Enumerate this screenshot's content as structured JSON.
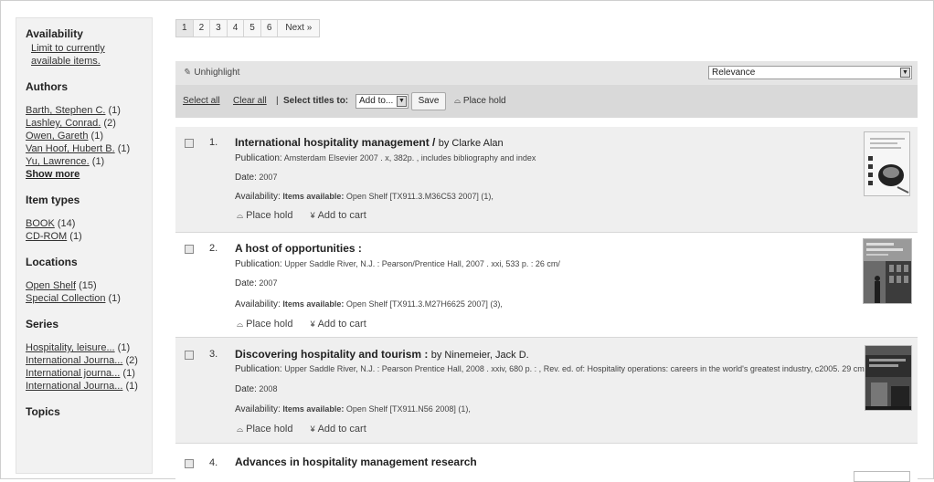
{
  "sidebar": {
    "availability": {
      "heading": "Availability",
      "link": "Limit to currently available items."
    },
    "authors": {
      "heading": "Authors",
      "items": [
        {
          "name": "Barth, Stephen C.",
          "count": "(1)"
        },
        {
          "name": "Lashley, Conrad.",
          "count": "(2)"
        },
        {
          "name": "Owen, Gareth",
          "count": "(1)"
        },
        {
          "name": "Van Hoof, Hubert B.",
          "count": "(1)"
        },
        {
          "name": "Yu, Lawrence.",
          "count": "(1)"
        }
      ],
      "show_more": "Show more"
    },
    "item_types": {
      "heading": "Item types",
      "items": [
        {
          "name": "BOOK",
          "count": "(14)"
        },
        {
          "name": "CD-ROM",
          "count": "(1)"
        }
      ]
    },
    "locations": {
      "heading": "Locations",
      "items": [
        {
          "name": "Open Shelf",
          "count": "(15)"
        },
        {
          "name": "Special Collection",
          "count": "(1)"
        }
      ]
    },
    "series": {
      "heading": "Series",
      "items": [
        {
          "name": "Hospitality, leisure...",
          "count": "(1)"
        },
        {
          "name": "International Journa...",
          "count": "(2)"
        },
        {
          "name": "International journa...",
          "count": "(1)"
        },
        {
          "name": "International Journa...",
          "count": "(1)"
        }
      ]
    },
    "topics": {
      "heading": "Topics"
    }
  },
  "pager": {
    "pages": [
      "1",
      "2",
      "3",
      "4",
      "5",
      "6"
    ],
    "next": "Next »",
    "current": "1"
  },
  "toolbar": {
    "unhighlight": "Unhighlight",
    "sort_value": "Relevance",
    "select_all": "Select all",
    "clear_all": "Clear all",
    "separator": "|",
    "select_titles_to": "Select titles to:",
    "add_to": "Add to...",
    "save": "Save",
    "place_hold": "Place hold"
  },
  "labels": {
    "publication": "Publication:",
    "date": "Date:",
    "availability": "Availability:",
    "items_available": "Items available:",
    "place_hold": "Place hold",
    "add_to_cart": "Add to cart"
  },
  "results": [
    {
      "num": "1.",
      "title": "International hospitality management /",
      "by": "by Clarke Alan",
      "publication": "Amsterdam Elsevier 2007 . x, 382p. , includes bibliography and index",
      "date": "2007",
      "availability": "Open Shelf [TX911.3.M36C53 2007] (1),"
    },
    {
      "num": "2.",
      "title": "A host of opportunities :",
      "by": "",
      "publication": "Upper Saddle River, N.J. : Pearson/Prentice Hall, 2007 . xxi, 533 p. : 26 cm/",
      "date": "2007",
      "availability": "Open Shelf [TX911.3.M27H6625 2007] (3),"
    },
    {
      "num": "3.",
      "title": "Discovering hospitality and tourism :",
      "by": "by Ninemeier, Jack D.",
      "publication": "Upper Saddle River, N.J. : Pearson Prentice Hall, 2008 . xxiv, 680 p. : , Rev. ed. of: Hospitality operations: careers in the world's greatest industry, c2005. 29 cm.",
      "date": "2008",
      "availability": "Open Shelf [TX911.N56 2008] (1),"
    },
    {
      "num": "4.",
      "title": "Advances in hospitality management research",
      "by": "",
      "publication": "",
      "date": "",
      "availability": ""
    }
  ]
}
